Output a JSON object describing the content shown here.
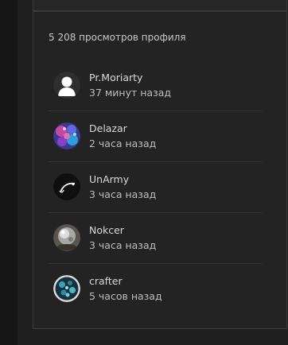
{
  "profile_views": {
    "text": "5 208 просмотров профиля"
  },
  "visitors": [
    {
      "name": "Pr.Moriarty",
      "time": "37 минут назад",
      "avatar_icon": "default-user-avatar"
    },
    {
      "name": "Delazar",
      "time": "2 часа назад",
      "avatar_icon": "colorful-abstract-avatar"
    },
    {
      "name": "UnArmy",
      "time": "3 часа назад",
      "avatar_icon": "dark-swirl-avatar"
    },
    {
      "name": "Nokcer",
      "time": "3 часа назад",
      "avatar_icon": "crystal-ball-avatar"
    },
    {
      "name": "crafter",
      "time": "5 часов назад",
      "avatar_icon": "blue-bokeh-avatar"
    }
  ]
}
